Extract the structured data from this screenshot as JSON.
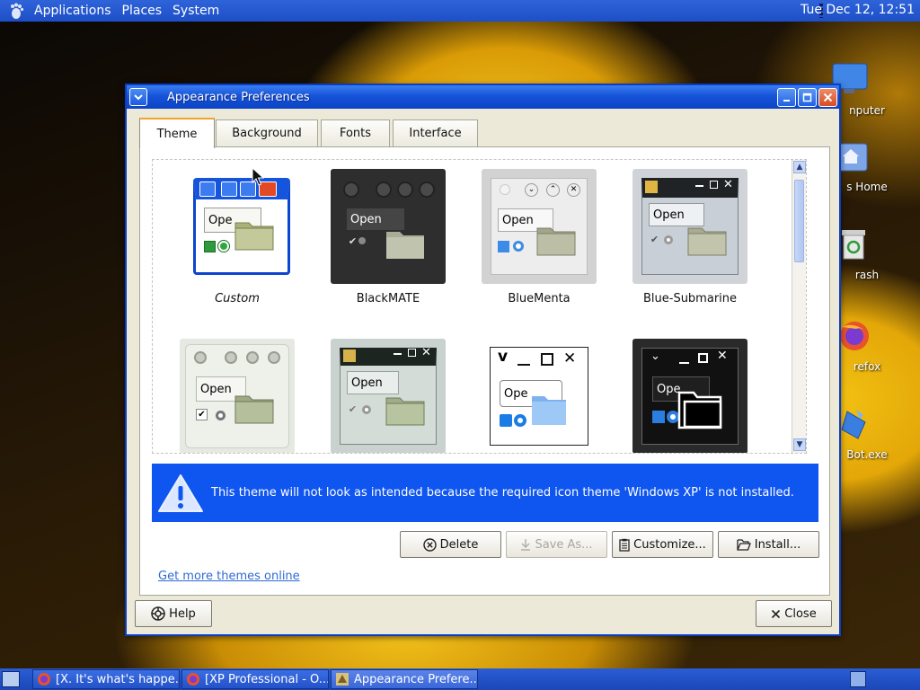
{
  "top_panel": {
    "menus": [
      "Applications",
      "Places",
      "System"
    ],
    "clock": "Tue Dec 12, 12:51"
  },
  "desktop_icons": [
    {
      "label": "nputer",
      "icon": "computer-icon"
    },
    {
      "label": "s Home",
      "icon": "home-folder-icon"
    },
    {
      "label": "rash",
      "icon": "trash-icon"
    },
    {
      "label": "refox",
      "icon": "firefox-icon"
    },
    {
      "label": "Bot.exe",
      "icon": "executable-icon"
    }
  ],
  "window": {
    "title": "Appearance Preferences",
    "tabs": [
      {
        "label": "Theme",
        "active": true
      },
      {
        "label": "Background",
        "active": false
      },
      {
        "label": "Fonts",
        "active": false
      },
      {
        "label": "Interface",
        "active": false
      }
    ],
    "themes": [
      {
        "name": "Custom",
        "selected": true
      },
      {
        "name": "BlackMATE",
        "selected": false
      },
      {
        "name": "BlueMenta",
        "selected": false
      },
      {
        "name": "Blue-Submarine",
        "selected": false
      },
      {
        "name": "",
        "selected": false
      },
      {
        "name": "",
        "selected": false
      },
      {
        "name": "",
        "selected": false
      },
      {
        "name": "",
        "selected": false
      }
    ],
    "preview_open_label": "Open",
    "preview_open_partial": "Ope",
    "warning": "This theme will not look as intended because the required icon theme 'Windows XP' is not installed.",
    "buttons": {
      "delete": "Delete",
      "save_as": "Save As...",
      "customize": "Customize...",
      "install": "Install..."
    },
    "more_link": "Get more themes online",
    "help": "Help",
    "close": "Close"
  },
  "taskbar": [
    {
      "label": "[X. It's what's happe...",
      "icon": "firefox-icon",
      "active": false
    },
    {
      "label": "[XP Professional - O...",
      "icon": "firefox-icon",
      "active": false
    },
    {
      "label": "Appearance Prefere...",
      "icon": "appearance-icon",
      "active": true
    }
  ],
  "colors": {
    "panel_blue": "#1d4fc6",
    "title_blue": "#0b44c5",
    "warning_blue": "#0f55f0",
    "window_bg": "#ece9d8",
    "link": "#2d6ad6"
  }
}
